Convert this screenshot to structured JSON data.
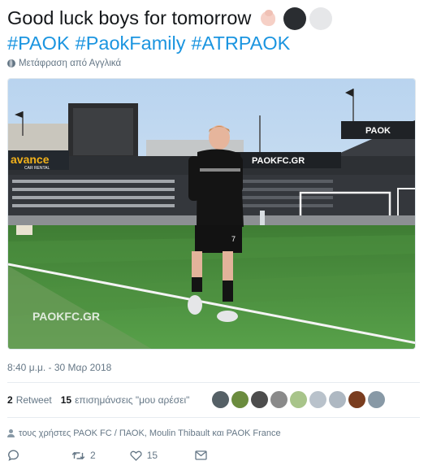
{
  "tweet": {
    "text": "Good luck boys for tomorrow",
    "emojis": [
      "flexed-biceps",
      "black-circle",
      "white-circle"
    ],
    "hashtags": [
      "#PAOK",
      "#PaokFamily",
      "#ATRPAOK"
    ]
  },
  "translate": {
    "label": "Μετάφραση από Αγγλικά"
  },
  "media": {
    "watermark": "PAOKFC.GR",
    "board_text": "PAOKFC.GR",
    "banner_text": "avance",
    "banner_sub": "CAR RENTAL",
    "stand_sign": "PAOK",
    "jersey_number": "7"
  },
  "timestamp": "8:40 μ.μ. - 30 Μαρ 2018",
  "stats": {
    "retweets_count": "2",
    "retweets_label": "Retweet",
    "likes_count": "15",
    "likes_label": "επισημάνσεις \"μου αρέσει\""
  },
  "liker_avatar_colors": [
    "#556066",
    "#6b8c3e",
    "#4d4d4d",
    "#8a8a8a",
    "#a8c48a",
    "#b9c2cb",
    "#aeb8c2",
    "#7a3d1f",
    "#8899a6"
  ],
  "replying_to": "τους χρήστες PAOK FC / ΠΑΟΚ, Moulin Thibault και PAOK France",
  "actions": {
    "reply_count": "",
    "retweet_count": "2",
    "like_count": "15"
  },
  "colors": {
    "link": "#1b95e0",
    "muted": "#657786"
  }
}
